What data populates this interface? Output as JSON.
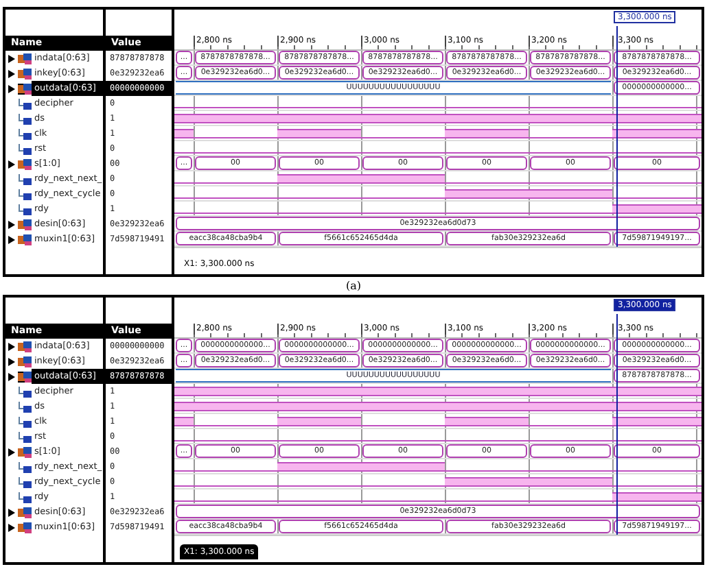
{
  "panels": [
    {
      "caption": "(a)",
      "cursor_label": "3,300.000 ns",
      "cursor_selected": false,
      "headers": {
        "name": "Name",
        "value": "Value"
      },
      "ticks": [
        "2,800 ns",
        "2,900 ns",
        "3,000 ns",
        "3,100 ns",
        "3,200 ns",
        "3,300 ns"
      ],
      "footer": "X1: 3,300.000 ns",
      "signals": [
        {
          "name": "indata[0:63]",
          "value": "87878787878",
          "kind": "bus",
          "selected": false,
          "segments": [
            {
              "text": "...",
              "kind": "valid"
            },
            {
              "text": "8787878787878...",
              "kind": "valid"
            },
            {
              "text": "8787878787878...",
              "kind": "valid"
            },
            {
              "text": "8787878787878...",
              "kind": "valid"
            },
            {
              "text": "8787878787878...",
              "kind": "valid"
            },
            {
              "text": "8787878787878...",
              "kind": "valid"
            },
            {
              "text": "8787878787878...",
              "kind": "valid"
            }
          ]
        },
        {
          "name": "inkey[0:63]",
          "value": "0e329232ea6",
          "kind": "bus",
          "selected": false,
          "segments": [
            {
              "text": "...",
              "kind": "valid"
            },
            {
              "text": "0e329232ea6d0...",
              "kind": "valid"
            },
            {
              "text": "0e329232ea6d0...",
              "kind": "valid"
            },
            {
              "text": "0e329232ea6d0...",
              "kind": "valid"
            },
            {
              "text": "0e329232ea6d0...",
              "kind": "valid"
            },
            {
              "text": "0e329232ea6d0...",
              "kind": "valid"
            },
            {
              "text": "0e329232ea6d0...",
              "kind": "valid"
            }
          ]
        },
        {
          "name": "outdata[0:63]",
          "value": "00000000000",
          "kind": "bus",
          "selected": true,
          "segments": [
            {
              "text": "UUUUUUUUUUUUUUUUU",
              "kind": "undefined"
            },
            {
              "kind": "continued"
            },
            {
              "kind": "continued"
            },
            {
              "kind": "continued"
            },
            {
              "kind": "continued"
            },
            {
              "kind": "continued"
            },
            {
              "text": "0000000000000...",
              "kind": "valid"
            }
          ]
        },
        {
          "name": "decipher",
          "value": "0",
          "kind": "bit",
          "selected": false,
          "high": [
            false,
            false,
            false,
            false,
            false,
            false,
            false
          ]
        },
        {
          "name": "ds",
          "value": "1",
          "kind": "bit",
          "selected": false,
          "high": [
            true,
            true,
            true,
            true,
            true,
            true,
            true
          ]
        },
        {
          "name": "clk",
          "value": "1",
          "kind": "bit",
          "selected": false,
          "high": [
            true,
            false,
            true,
            false,
            true,
            false,
            true
          ]
        },
        {
          "name": "rst",
          "value": "0",
          "kind": "bit",
          "selected": false,
          "high": [
            false,
            false,
            false,
            false,
            false,
            false,
            false
          ]
        },
        {
          "name": "s[1:0]",
          "value": "00",
          "kind": "bus",
          "selected": false,
          "segments": [
            {
              "text": "...",
              "kind": "valid"
            },
            {
              "text": "00",
              "kind": "valid"
            },
            {
              "text": "00",
              "kind": "valid"
            },
            {
              "text": "00",
              "kind": "valid"
            },
            {
              "text": "00",
              "kind": "valid"
            },
            {
              "text": "00",
              "kind": "valid"
            },
            {
              "text": "00",
              "kind": "valid"
            }
          ]
        },
        {
          "name": "rdy_next_next_",
          "value": "0",
          "kind": "bit",
          "selected": false,
          "high": [
            false,
            false,
            true,
            true,
            false,
            false,
            false
          ]
        },
        {
          "name": "rdy_next_cycle",
          "value": "0",
          "kind": "bit",
          "selected": false,
          "high": [
            false,
            false,
            false,
            false,
            true,
            true,
            false
          ]
        },
        {
          "name": "rdy",
          "value": "1",
          "kind": "bit",
          "selected": false,
          "high": [
            false,
            false,
            false,
            false,
            false,
            false,
            true
          ]
        },
        {
          "name": "desin[0:63]",
          "value": "0e329232ea6",
          "kind": "bus",
          "selected": false,
          "segments": [
            {
              "text": "0e329232ea6d0d73",
              "kind": "valid"
            },
            {
              "kind": "continued"
            },
            {
              "kind": "continued"
            },
            {
              "kind": "continued"
            },
            {
              "kind": "continued"
            },
            {
              "kind": "continued"
            },
            {
              "kind": "continued"
            }
          ]
        },
        {
          "name": "muxin1[0:63]",
          "value": "7d598719491",
          "kind": "bus",
          "selected": false,
          "segments": [
            {
              "text": "eacc38ca48cba9b4",
              "kind": "valid"
            },
            {
              "kind": "continued"
            },
            {
              "text": "f5661c652465d4da",
              "kind": "valid"
            },
            {
              "kind": "continued"
            },
            {
              "text": "fab30e329232ea6d",
              "kind": "valid"
            },
            {
              "kind": "continued"
            },
            {
              "text": "7d59871949197...",
              "kind": "valid"
            }
          ]
        }
      ]
    },
    {
      "cursor_label": "3,300.000 ns",
      "cursor_selected": true,
      "headers": {
        "name": "Name",
        "value": "Value"
      },
      "ticks": [
        "2,800 ns",
        "2,900 ns",
        "3,000 ns",
        "3,100 ns",
        "3,200 ns",
        "3,300 ns"
      ],
      "footer": "X1: 3,300.000 ns",
      "signals": [
        {
          "name": "indata[0:63]",
          "value": "00000000000",
          "kind": "bus",
          "selected": false,
          "segments": [
            {
              "text": "...",
              "kind": "valid"
            },
            {
              "text": "0000000000000...",
              "kind": "valid"
            },
            {
              "text": "0000000000000...",
              "kind": "valid"
            },
            {
              "text": "0000000000000...",
              "kind": "valid"
            },
            {
              "text": "0000000000000...",
              "kind": "valid"
            },
            {
              "text": "0000000000000...",
              "kind": "valid"
            },
            {
              "text": "0000000000000...",
              "kind": "valid"
            }
          ]
        },
        {
          "name": "inkey[0:63]",
          "value": "0e329232ea6",
          "kind": "bus",
          "selected": false,
          "segments": [
            {
              "text": "...",
              "kind": "valid"
            },
            {
              "text": "0e329232ea6d0...",
              "kind": "valid"
            },
            {
              "text": "0e329232ea6d0...",
              "kind": "valid"
            },
            {
              "text": "0e329232ea6d0...",
              "kind": "valid"
            },
            {
              "text": "0e329232ea6d0...",
              "kind": "valid"
            },
            {
              "text": "0e329232ea6d0...",
              "kind": "valid"
            },
            {
              "text": "0e329232ea6d0...",
              "kind": "valid"
            }
          ]
        },
        {
          "name": "outdata[0:63]",
          "value": "87878787878",
          "kind": "bus",
          "selected": true,
          "segments": [
            {
              "text": "UUUUUUUUUUUUUUUUU",
              "kind": "undefined"
            },
            {
              "kind": "continued"
            },
            {
              "kind": "continued"
            },
            {
              "kind": "continued"
            },
            {
              "kind": "continued"
            },
            {
              "kind": "continued"
            },
            {
              "text": "8787878787878...",
              "kind": "valid"
            }
          ]
        },
        {
          "name": "decipher",
          "value": "1",
          "kind": "bit",
          "selected": false,
          "high": [
            true,
            true,
            true,
            true,
            true,
            true,
            true
          ]
        },
        {
          "name": "ds",
          "value": "1",
          "kind": "bit",
          "selected": false,
          "high": [
            true,
            true,
            true,
            true,
            true,
            true,
            true
          ]
        },
        {
          "name": "clk",
          "value": "1",
          "kind": "bit",
          "selected": false,
          "high": [
            true,
            false,
            true,
            false,
            true,
            false,
            true
          ]
        },
        {
          "name": "rst",
          "value": "0",
          "kind": "bit",
          "selected": false,
          "high": [
            false,
            false,
            false,
            false,
            false,
            false,
            false
          ]
        },
        {
          "name": "s[1:0]",
          "value": "00",
          "kind": "bus",
          "selected": false,
          "segments": [
            {
              "text": "...",
              "kind": "valid"
            },
            {
              "text": "00",
              "kind": "valid"
            },
            {
              "text": "00",
              "kind": "valid"
            },
            {
              "text": "00",
              "kind": "valid"
            },
            {
              "text": "00",
              "kind": "valid"
            },
            {
              "text": "00",
              "kind": "valid"
            },
            {
              "text": "00",
              "kind": "valid"
            }
          ]
        },
        {
          "name": "rdy_next_next_",
          "value": "0",
          "kind": "bit",
          "selected": false,
          "high": [
            false,
            false,
            true,
            true,
            false,
            false,
            false
          ]
        },
        {
          "name": "rdy_next_cycle",
          "value": "0",
          "kind": "bit",
          "selected": false,
          "high": [
            false,
            false,
            false,
            false,
            true,
            true,
            false
          ]
        },
        {
          "name": "rdy",
          "value": "1",
          "kind": "bit",
          "selected": false,
          "high": [
            false,
            false,
            false,
            false,
            false,
            false,
            true
          ]
        },
        {
          "name": "desin[0:63]",
          "value": "0e329232ea6",
          "kind": "bus",
          "selected": false,
          "segments": [
            {
              "text": "0e329232ea6d0d73",
              "kind": "valid"
            },
            {
              "kind": "continued"
            },
            {
              "kind": "continued"
            },
            {
              "kind": "continued"
            },
            {
              "kind": "continued"
            },
            {
              "kind": "continued"
            },
            {
              "kind": "continued"
            }
          ]
        },
        {
          "name": "muxin1[0:63]",
          "value": "7d598719491",
          "kind": "bus",
          "selected": false,
          "segments": [
            {
              "text": "eacc38ca48cba9b4",
              "kind": "valid"
            },
            {
              "kind": "continued"
            },
            {
              "text": "f5661c652465d4da",
              "kind": "valid"
            },
            {
              "kind": "continued"
            },
            {
              "text": "fab30e329232ea6d",
              "kind": "valid"
            },
            {
              "kind": "continued"
            },
            {
              "text": "7d59871949197...",
              "kind": "valid"
            }
          ]
        }
      ]
    }
  ]
}
